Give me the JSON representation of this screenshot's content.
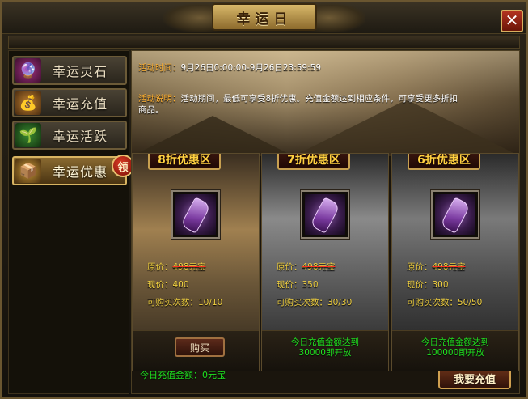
{
  "window": {
    "title": "幸运日",
    "close_label": "✕"
  },
  "sidebar": {
    "items": [
      {
        "label": "幸运灵石",
        "icon": "spirit-stone-icon",
        "glyph": "🔮",
        "active": false
      },
      {
        "label": "幸运充值",
        "icon": "money-bag-icon",
        "glyph": "💰",
        "active": false
      },
      {
        "label": "幸运活跃",
        "icon": "sprout-icon",
        "glyph": "🌱",
        "active": false
      },
      {
        "label": "幸运优惠",
        "icon": "treasure-chest-icon",
        "glyph": "📦",
        "active": true
      }
    ],
    "badge": "领"
  },
  "banner": {
    "time_label": "活动时间：",
    "time_value": "9月26日0:00:00-9月26日23:59:59",
    "desc_label": "活动说明：",
    "desc_value": "活动期间，最低可享受8折优惠。充值金额达到相应条件，可享受更多折扣商品。"
  },
  "cards": [
    {
      "tab": "8折优惠区",
      "orig_label": "原价：",
      "orig_value": "498元宝",
      "now_label": "现价：",
      "now_value": "400",
      "limit_label": "可购买次数：",
      "limit_value": "10/10",
      "button": "购买",
      "unlock_line1": "",
      "unlock_line2": ""
    },
    {
      "tab": "7折优惠区",
      "orig_label": "原价：",
      "orig_value": "498元宝",
      "now_label": "现价：",
      "now_value": "350",
      "limit_label": "可购买次数：",
      "limit_value": "30/30",
      "button": "",
      "unlock_line1": "今日充值金额达到",
      "unlock_line2": "30000即开放"
    },
    {
      "tab": "6折优惠区",
      "orig_label": "原价：",
      "orig_value": "498元宝",
      "now_label": "现价：",
      "now_value": "300",
      "limit_label": "可购买次数：",
      "limit_value": "50/50",
      "button": "",
      "unlock_line1": "今日充值金额达到",
      "unlock_line2": "100000即开放"
    }
  ],
  "footer": {
    "total_label": "今日充值金额：",
    "total_value": "0元宝",
    "recharge_button": "我要充值"
  },
  "colors": {
    "accent_gold": "#d8b462",
    "price_yellow": "#f0d040",
    "unlock_green": "#20e020",
    "label_orange": "#ffb030"
  }
}
